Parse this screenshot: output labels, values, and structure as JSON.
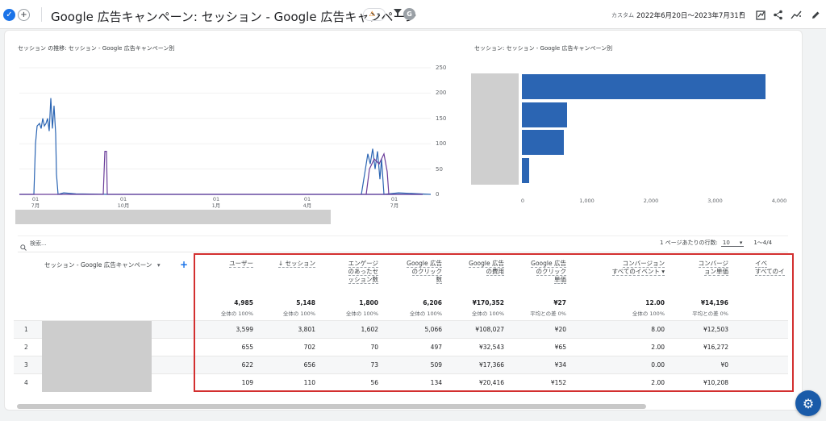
{
  "header": {
    "title": "Google 広告キャンペーン: セッション - Google 広告キャンペーン",
    "date_label": "カスタム",
    "date_range": "2022年6月20日～2023年7月31日"
  },
  "line_chart": {
    "title": "セッション の推移: セッション - Google 広告キャンペーン別",
    "y_ticks": [
      "250",
      "200",
      "150",
      "100",
      "50",
      "0"
    ],
    "x_ticks": [
      {
        "day": "01",
        "month": "7月"
      },
      {
        "day": "01",
        "month": "10月"
      },
      {
        "day": "01",
        "month": "1月"
      },
      {
        "day": "01",
        "month": "4月"
      },
      {
        "day": "01",
        "month": "7月"
      }
    ]
  },
  "bar_chart": {
    "title": "セッション: セッション - Google 広告キャンペーン別",
    "x_ticks": [
      "0",
      "1,000",
      "2,000",
      "3,000",
      "4,000"
    ]
  },
  "chart_data": [
    {
      "type": "line",
      "title": "セッション の推移: セッション - Google 広告キャンペーン別",
      "ylim": [
        0,
        250
      ],
      "x": [
        "2022-06-20",
        "2022-07-01",
        "2022-07-15",
        "2022-08-01",
        "2022-08-20",
        "2022-09-01",
        "2022-10-01",
        "2023-01-01",
        "2023-04-01",
        "2023-06-10",
        "2023-06-25",
        "2023-07-10",
        "2023-07-31"
      ],
      "series": [
        {
          "values": [
            0,
            140,
            190,
            3,
            0,
            0,
            0,
            0,
            0,
            0,
            80,
            60,
            0
          ]
        },
        {
          "values": [
            0,
            0,
            0,
            0,
            0,
            90,
            0,
            0,
            0,
            0,
            60,
            50,
            0
          ]
        }
      ]
    },
    {
      "type": "bar",
      "title": "セッション: セッション - Google 広告キャンペーン別",
      "categories": [
        "1",
        "2",
        "3",
        "4"
      ],
      "values": [
        3801,
        702,
        656,
        110
      ],
      "xlim": [
        0,
        4000
      ],
      "orientation": "horizontal",
      "color": "#2b65b3"
    }
  ],
  "table": {
    "search_placeholder": "検索...",
    "rows_per_page_label": "1 ページあたりの行数:",
    "rows_per_page": "10",
    "range": "1～4/4",
    "dimension_header": "セッション - Google 広告キャンペーン",
    "columns": [
      {
        "label": [
          "ユーザー"
        ],
        "total": "4,985",
        "sub": "全体の 100%"
      },
      {
        "label": [
          "↓ セッション"
        ],
        "total": "5,148",
        "sub": "全体の 100%"
      },
      {
        "label": [
          "エンゲージ",
          "のあったセ",
          "ッション数"
        ],
        "total": "1,800",
        "sub": "全体の 100%"
      },
      {
        "label": [
          "Google 広告",
          "のクリック",
          "数"
        ],
        "total": "6,206",
        "sub": "全体の 100%"
      },
      {
        "label": [
          "Google 広告",
          "の費用"
        ],
        "total": "¥170,352",
        "sub": "全体の 100%"
      },
      {
        "label": [
          "Google 広告",
          "のクリック",
          "単価"
        ],
        "total": "¥27",
        "sub": "平均との差 0%"
      },
      {
        "label": [
          "コンバージョン",
          "すべてのイベント ▾"
        ],
        "total": "12.00",
        "sub": "全体の 100%"
      },
      {
        "label": [
          "コンバージ",
          "ョン単価"
        ],
        "total": "¥14,196",
        "sub": "平均との差 0%"
      },
      {
        "label": [
          "イベ",
          "すべてのイ"
        ],
        "total": "",
        "sub": ""
      }
    ],
    "rows": [
      {
        "num": "1",
        "cells": [
          "3,599",
          "3,801",
          "1,602",
          "5,066",
          "¥108,027",
          "¥20",
          "8.00",
          "¥12,503"
        ]
      },
      {
        "num": "2",
        "cells": [
          "655",
          "702",
          "70",
          "497",
          "¥32,543",
          "¥65",
          "2.00",
          "¥16,272"
        ]
      },
      {
        "num": "3",
        "cells": [
          "622",
          "656",
          "73",
          "509",
          "¥17,366",
          "¥34",
          "0.00",
          "¥0"
        ]
      },
      {
        "num": "4",
        "cells": [
          "109",
          "110",
          "56",
          "134",
          "¥20,416",
          "¥152",
          "2.00",
          "¥10,208"
        ]
      }
    ]
  }
}
